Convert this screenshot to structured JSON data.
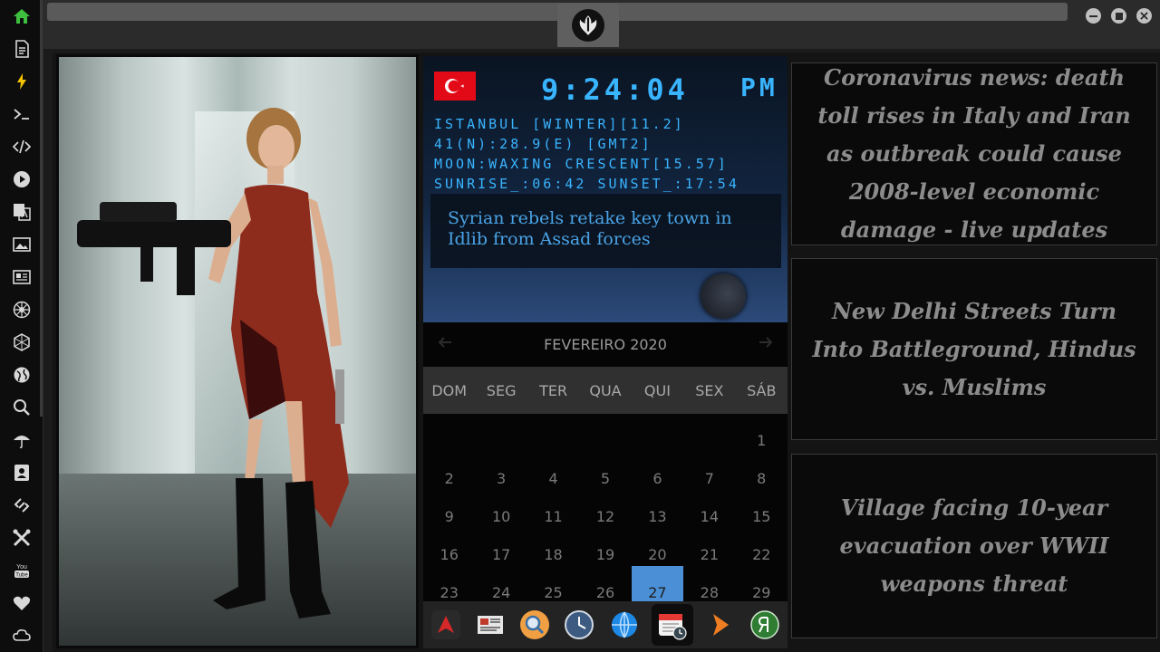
{
  "sidebar": {
    "items": [
      {
        "icon": "home-icon",
        "color": "#3fbf3f"
      },
      {
        "icon": "document-icon"
      },
      {
        "icon": "lightning-icon",
        "color": "#f2c200"
      },
      {
        "icon": "terminal-icon"
      },
      {
        "icon": "code-icon"
      },
      {
        "icon": "play-icon"
      },
      {
        "icon": "translate-icon"
      },
      {
        "icon": "image-icon"
      },
      {
        "icon": "news-icon"
      },
      {
        "icon": "empire-icon"
      },
      {
        "icon": "hexagon-icon"
      },
      {
        "icon": "globe-icon"
      },
      {
        "icon": "search-icon"
      },
      {
        "icon": "umbrella-icon"
      },
      {
        "icon": "contacts-icon"
      },
      {
        "icon": "link-icon"
      },
      {
        "icon": "tools-icon"
      },
      {
        "icon": "youtube-icon",
        "text": "You Tube"
      },
      {
        "icon": "heart-icon"
      },
      {
        "icon": "cloud-icon"
      }
    ]
  },
  "topbar": {
    "logo": "rebel-alliance-icon",
    "window_controls": [
      "minimize-icon",
      "maximize-icon",
      "close-icon"
    ]
  },
  "clock": {
    "flag": "turkey-flag-icon",
    "time": "9:24:04",
    "ampm": "PM",
    "location": "ISTANBUL [WINTER][11.2]",
    "coords": "41(N):28.9(E) [GMT2]",
    "moon": "MOON:WAXING CRESCENT[15.57]",
    "sun": "SUNRISE_:06:42 SUNSET_:17:54",
    "news": "Syrian rebels retake key town in Idlib from Assad forces"
  },
  "calendar": {
    "month": "FEVEREIRO 2020",
    "weekdays": [
      "DOM",
      "SEG",
      "TER",
      "QUA",
      "QUI",
      "SEX",
      "SÁB"
    ],
    "days": [
      [
        "",
        "",
        "",
        "",
        "",
        "",
        "1"
      ],
      [
        "2",
        "3",
        "4",
        "5",
        "6",
        "7",
        "8"
      ],
      [
        "9",
        "10",
        "11",
        "12",
        "13",
        "14",
        "15"
      ],
      [
        "16",
        "17",
        "18",
        "19",
        "20",
        "21",
        "22"
      ],
      [
        "23",
        "24",
        "25",
        "26",
        "27",
        "28",
        "29"
      ]
    ],
    "today": "27",
    "today_color": "#4b8fd6"
  },
  "dock": {
    "apps": [
      "launcher-icon",
      "newspaper-icon",
      "search-icon",
      "clock-icon",
      "globe-icon",
      "calendar-icon",
      "forward-icon",
      "yandex-icon"
    ],
    "active": "calendar-icon"
  },
  "headlines": [
    "Coronavirus news: death toll rises in Italy and Iran as outbreak could cause 2008-level economic damage - live updates",
    "New Delhi Streets Turn Into Battleground, Hindus vs. Muslims",
    "Village facing 10-year evacuation over WWII weapons threat"
  ]
}
